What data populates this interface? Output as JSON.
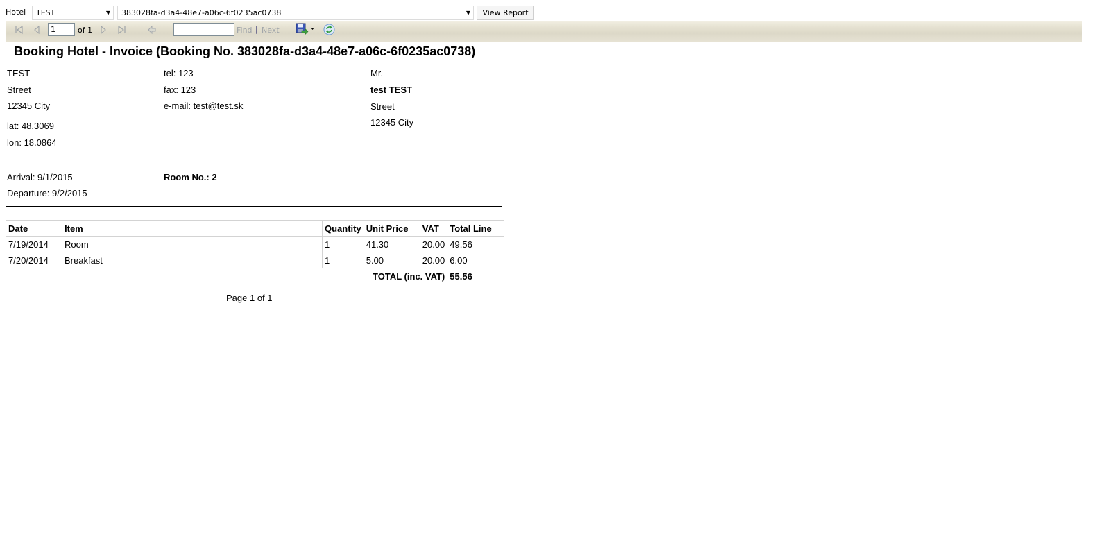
{
  "params": {
    "hotel_label": "Hotel",
    "hotel_value": "TEST",
    "booking_value": "383028fa-d3a4-48e7-a06c-6f0235ac0738",
    "view_report_label": "View Report"
  },
  "toolbar": {
    "current_page": "1",
    "page_of": "of 1",
    "find_value": "",
    "find_label": "Find",
    "separator": "|",
    "next_label": "Next",
    "icons": [
      "first-page-icon",
      "previous-page-icon",
      "next-page-icon",
      "last-page-icon",
      "back-icon",
      "export-save-icon",
      "dropdown-arrow-icon",
      "refresh-icon"
    ]
  },
  "report": {
    "title": "Booking Hotel - Invoice (Booking No. 383028fa-d3a4-48e7-a06c-6f0235ac0738)",
    "hotel": {
      "name": "TEST",
      "street": "Street",
      "city": "12345 City",
      "lat": "lat: 48.3069",
      "lon": "lon: 18.0864"
    },
    "contact": {
      "tel": "tel: 123",
      "fax": "fax: 123",
      "email": "e-mail: test@test.sk"
    },
    "guest": {
      "salutation": "Mr.",
      "name": "test TEST",
      "street": "Street",
      "city": "12345 City"
    },
    "stay": {
      "arrival": "Arrival: 9/1/2015",
      "departure": "Departure: 9/2/2015",
      "room": "Room No.: 2"
    },
    "table": {
      "headers": [
        "Date",
        "Item",
        "Quantity",
        "Unit Price",
        "VAT",
        "Total Line"
      ],
      "rows": [
        [
          "7/19/2014",
          "Room",
          "1",
          "41.30",
          "20.00",
          "49.56"
        ],
        [
          "7/20/2014",
          "Breakfast",
          "1",
          "5.00",
          "20.00",
          "6.00"
        ]
      ],
      "total_label": "TOTAL (inc. VAT)",
      "total_value": "55.56"
    },
    "footer": "Page 1 of 1"
  }
}
